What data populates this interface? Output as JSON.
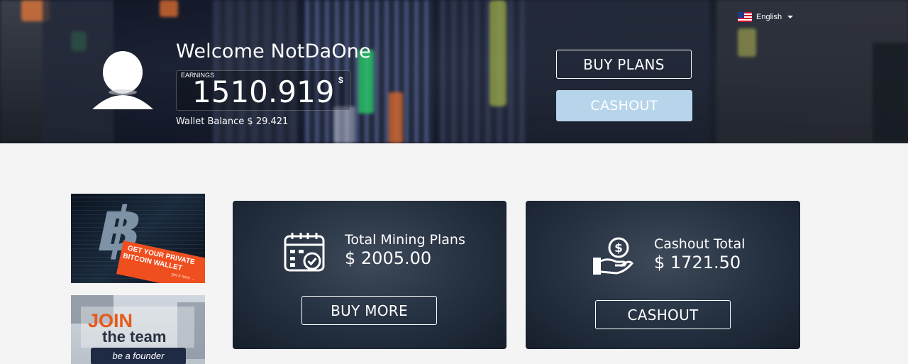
{
  "header": {
    "language": {
      "label": "English",
      "flag_icon": "us-flag-icon"
    },
    "welcome_text": "Welcome NotDaOne",
    "earnings": {
      "label": "EARNINGS",
      "value": "1510.919",
      "currency": "$"
    },
    "wallet_balance": "Wallet Balance $ 29.421",
    "buy_plans_label": "BUY PLANS",
    "cashout_label": "CASHOUT",
    "colors": {
      "cashout_bg": "#b6d4ea"
    }
  },
  "sidebar": {
    "ad_wallet": {
      "line1": "GET YOUR PRIVATE",
      "line2": "BITCOIN WALLET",
      "line3": "get it here →",
      "accent": "#ef4e1e"
    },
    "ad_join": {
      "line1": "JOIN",
      "line2": "the team",
      "line3": "be a founder",
      "accent": "#e65a1b"
    }
  },
  "cards": {
    "mining": {
      "icon": "calendar-check-icon",
      "title": "Total Mining Plans",
      "value": "$ 2005.00",
      "button": "BUY MORE"
    },
    "cashout": {
      "icon": "hand-coin-icon",
      "title": "Cashout Total",
      "value": "$ 1721.50",
      "button": "CASHOUT"
    }
  }
}
